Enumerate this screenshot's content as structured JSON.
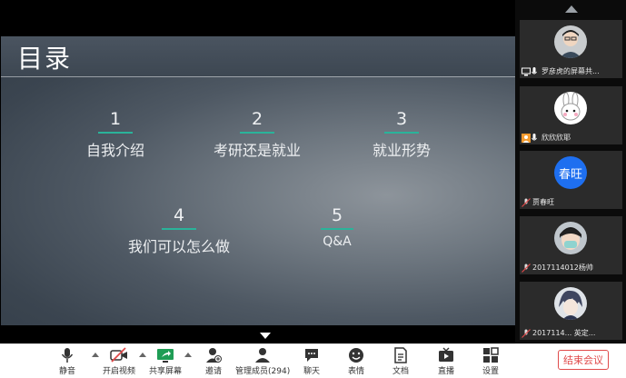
{
  "slide": {
    "title": "目录",
    "toc": [
      {
        "num": "1",
        "label": "自我介绍"
      },
      {
        "num": "2",
        "label": "考研还是就业"
      },
      {
        "num": "3",
        "label": "就业形势"
      },
      {
        "num": "4",
        "label": "我们可以怎么做"
      },
      {
        "num": "5",
        "label": "Q&A"
      }
    ]
  },
  "participants": [
    {
      "name": "罗彦虎的屏幕共...",
      "avatar": "photo-avatar",
      "status": "screen-share"
    },
    {
      "name": "欣欣欣耶",
      "avatar": "rabbit-avatar",
      "status": "host"
    },
    {
      "name": "贾春旺",
      "avatar_text": "春旺",
      "status": "muted"
    },
    {
      "name": "2017114012杨帅",
      "avatar": "mask-avatar",
      "status": "muted"
    },
    {
      "name": "2017114... 英定...",
      "avatar": "anime-avatar",
      "status": "muted"
    }
  ],
  "toolbar": {
    "mute": "静音",
    "video": "开启视频",
    "share": "共享屏幕",
    "invite": "邀请",
    "members": "管理成员(294)",
    "chat": "聊天",
    "emoji": "表情",
    "docs": "文档",
    "live": "直播",
    "settings": "设置",
    "end": "结束会议"
  },
  "colors": {
    "accent": "#2ab39a",
    "end": "#e04a4a",
    "avatar_blue": "#1e6ff0"
  }
}
